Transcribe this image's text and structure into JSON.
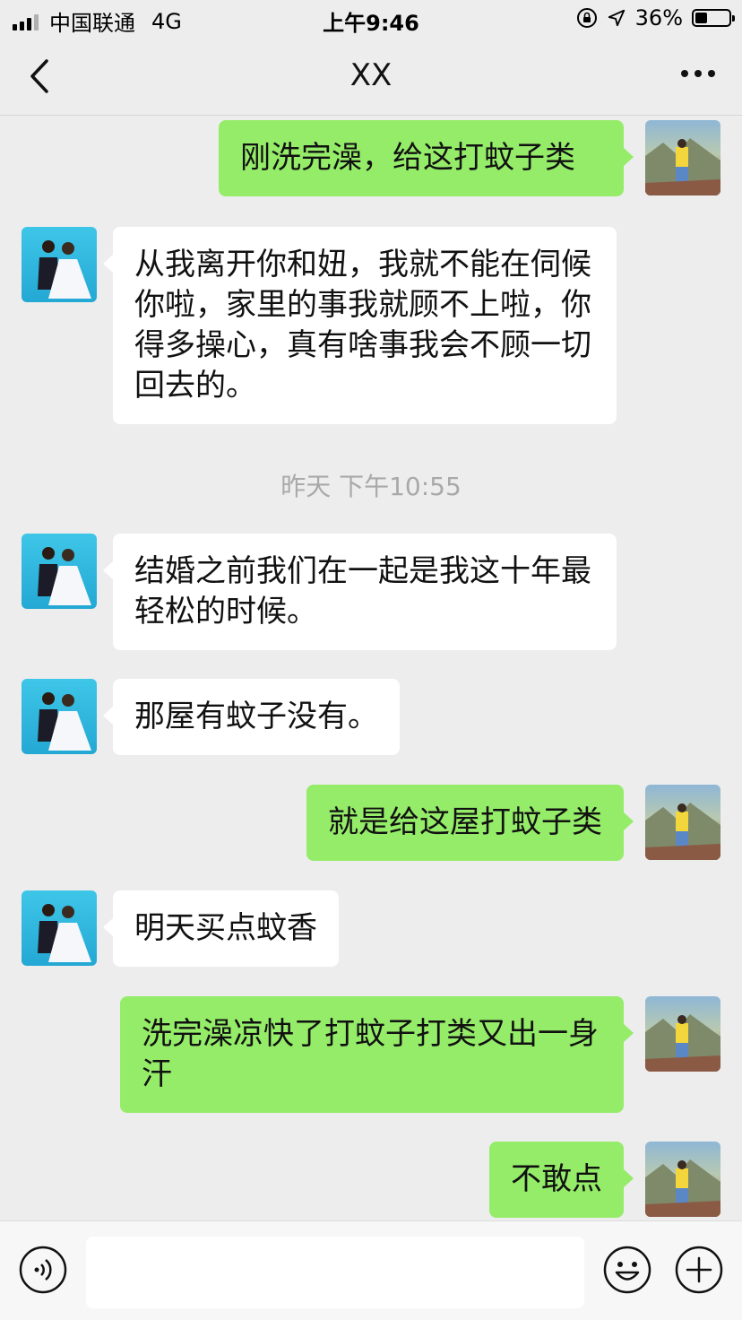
{
  "status_bar": {
    "carrier": "中国联通",
    "network": "4G",
    "time": "上午9:46",
    "battery": "36%",
    "battery_level": 0.36
  },
  "header": {
    "title": "XX"
  },
  "messages": [
    {
      "from": "me",
      "text": "刚洗完澡，给这打蚊子类"
    },
    {
      "from": "them",
      "text": "从我离开你和妞，我就不能在伺候你啦，家里的事我就顾不上啦，你得多操心，真有啥事我会不顾一切回去的。"
    },
    {
      "type": "timestamp",
      "text": "昨天 下午10:55"
    },
    {
      "from": "them",
      "text": "结婚之前我们在一起是我这十年最轻松的时候。"
    },
    {
      "from": "them",
      "text": "那屋有蚊子没有。"
    },
    {
      "from": "me",
      "text": "就是给这屋打蚊子类"
    },
    {
      "from": "them",
      "text": "明天买点蚊香"
    },
    {
      "from": "me",
      "text": "洗完澡凉快了打蚊子打类又出一身汗"
    },
    {
      "from": "me",
      "text": "不敢点"
    }
  ],
  "icons": {
    "back": "chevron-left-icon",
    "more": "ellipsis-icon",
    "voice": "voice-icon",
    "emoji": "emoji-icon",
    "plus": "plus-icon",
    "location": "location-arrow-icon",
    "orientation_lock": "orientation-lock-icon"
  },
  "colors": {
    "background": "#ededed",
    "my_bubble": "#95ec69",
    "their_bubble": "#ffffff",
    "timestamp": "#a9a9a9"
  }
}
